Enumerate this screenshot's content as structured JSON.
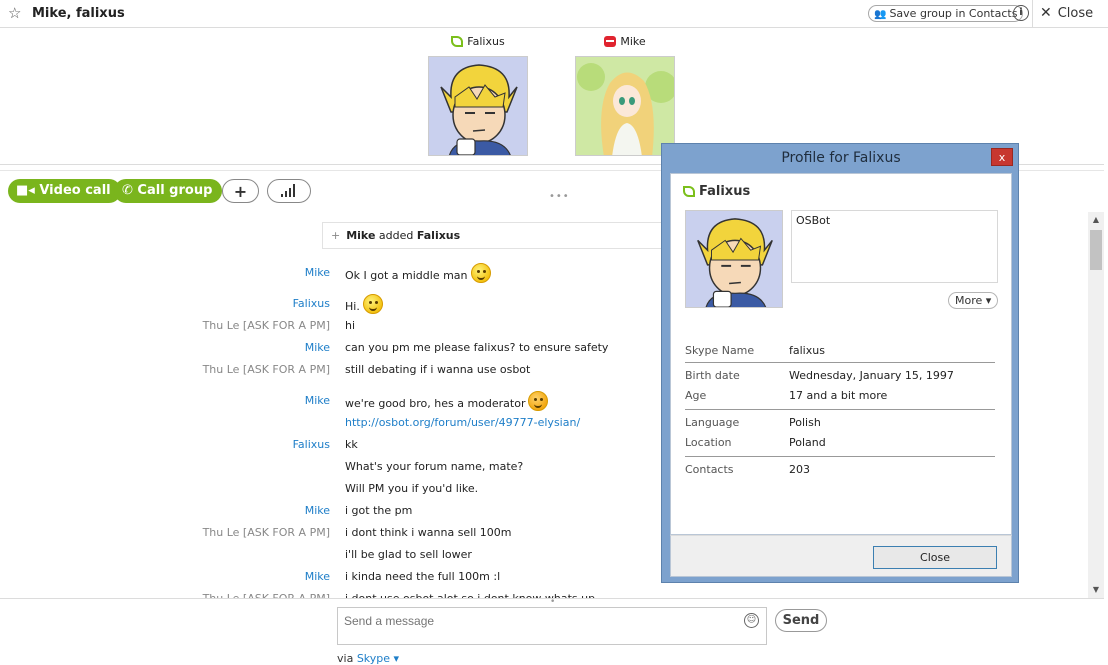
{
  "titlebar": {
    "title": "Mike, falixus",
    "save_group_label": "Save group in Contacts",
    "info_label": "i",
    "close_label": "Close"
  },
  "participants": [
    {
      "name": "Falixus",
      "status": "online"
    },
    {
      "name": "Mike",
      "status": "busy"
    }
  ],
  "toolbar": {
    "video_call_label": "Video call",
    "call_group_label": "Call group",
    "add_label": "+"
  },
  "chat": {
    "event": {
      "actor": "Mike",
      "verb": " added ",
      "target": "Falixus"
    },
    "messages": [
      {
        "sender": "Mike",
        "text": "Ok I got a middle man",
        "emoji": "smile"
      },
      {
        "sender": "Falixus",
        "text": "Hi.",
        "emoji": "smile"
      },
      {
        "sender": "Thu Le [ASK FOR A PM]",
        "text": "hi"
      },
      {
        "sender": "Mike",
        "text": "can you pm me please falixus? to ensure safety"
      },
      {
        "sender": "Thu Le [ASK FOR A PM]",
        "text": "still debating if i wanna use osbot"
      },
      {
        "sender": "Mike",
        "text": "we're good bro, hes a moderator",
        "emoji": "tongue"
      },
      {
        "sender": "",
        "text": "http://osbot.org/forum/user/49777-elysian/",
        "link": true
      },
      {
        "sender": "Falixus",
        "text": "kk"
      },
      {
        "sender": "",
        "text": "What's your forum name, mate?"
      },
      {
        "sender": "",
        "text": "Will PM you if you'd like."
      },
      {
        "sender": "Mike",
        "text": "i got the pm"
      },
      {
        "sender": "Thu Le [ASK FOR A PM]",
        "text": "i dont think i wanna sell 100m"
      },
      {
        "sender": "",
        "text": "i'll be glad to sell lower"
      },
      {
        "sender": "Mike",
        "text": "i kinda need the full 100m :l"
      },
      {
        "sender": "Thu Le [ASK FOR A PM]",
        "text": "i dont use osbot alot so i dont know whats up"
      }
    ]
  },
  "composer": {
    "placeholder": "Send a message",
    "send_label": "Send",
    "via_label": "via",
    "via_service": "Skype"
  },
  "profile": {
    "window_title": "Profile for Falixus",
    "close_x": "x",
    "name": "Falixus",
    "mood": "OSBot",
    "more_label": "More",
    "fields": {
      "skype_name_label": "Skype Name",
      "skype_name": "falixus",
      "birth_label": "Birth date",
      "birth": "Wednesday, January 15, 1997",
      "age_label": "Age",
      "age": "17 and a bit more",
      "language_label": "Language",
      "language": "Polish",
      "location_label": "Location",
      "location": "Poland",
      "contacts_label": "Contacts",
      "contacts": "203"
    },
    "close_button_label": "Close"
  },
  "colors": {
    "accent_green": "#7ab51d",
    "link_blue": "#1e7ec8",
    "dialog_frame": "#7da2ce",
    "dialog_close": "#c7372f"
  }
}
